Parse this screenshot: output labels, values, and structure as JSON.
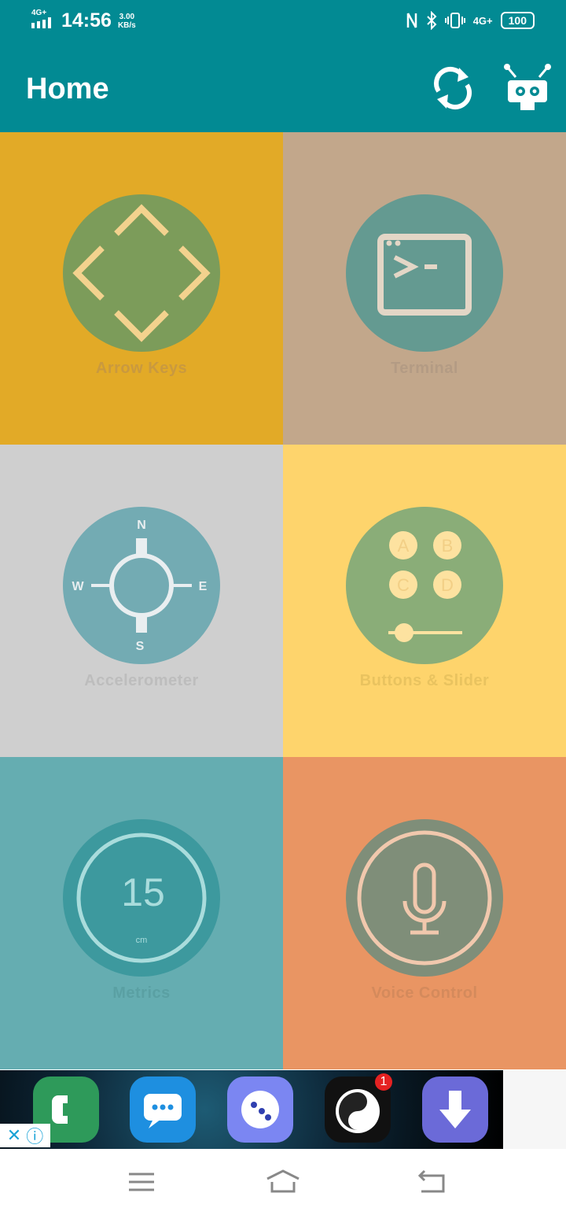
{
  "status_bar": {
    "signal_label": "4G+",
    "time": "14:56",
    "speed_value": "3.00",
    "speed_unit": "KB/s",
    "net_label": "4G+",
    "battery": "100"
  },
  "app_bar": {
    "title": "Home",
    "refresh_icon": "refresh-icon",
    "settings_icon": "robot-gear-icon"
  },
  "tiles": [
    {
      "label": "Arrow Keys",
      "bg": "#e2aa27",
      "circle": "#7c9c5a",
      "label_color": "#c9993f",
      "icon": "arrow-keys-icon"
    },
    {
      "label": "Terminal",
      "bg": "#c2a78b",
      "circle": "#649a91",
      "label_color": "#b39b84",
      "icon": "terminal-icon"
    },
    {
      "label": "Accelerometer",
      "bg": "#cfcfcf",
      "circle": "#73abb3",
      "label_color": "#bdbdbd",
      "icon": "compass-icon",
      "compass": {
        "n": "N",
        "s": "S",
        "e": "E",
        "w": "W"
      }
    },
    {
      "label": "Buttons & Slider",
      "bg": "#fed46c",
      "circle": "#8aad78",
      "label_color": "#e9c35f",
      "icon": "buttons-slider-icon",
      "buttons": {
        "a": "A",
        "b": "B",
        "c": "C",
        "d": "D"
      }
    },
    {
      "label": "Metrics",
      "bg": "#65adb1",
      "circle": "#3d999e",
      "label_color": "#5aa0a3",
      "icon": "metrics-gauge-icon",
      "value": "15",
      "unit": "cm"
    },
    {
      "label": "Voice Control",
      "bg": "#e99563",
      "circle": "#7f8e79",
      "label_color": "#d48a5c",
      "icon": "microphone-icon"
    }
  ],
  "ad": {
    "badge_count": "1",
    "close_glyph": "✕",
    "info_glyph": "ⓘ"
  }
}
